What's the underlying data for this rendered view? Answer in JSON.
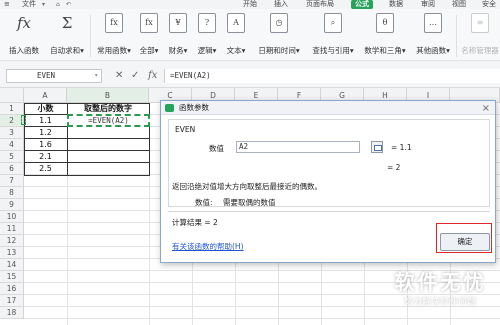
{
  "menubar": {
    "file": "文件",
    "tabs": [
      "开始",
      "插入",
      "页面布局",
      "公式",
      "数据",
      "审阅",
      "视图",
      "安全"
    ],
    "active_tab": "公式",
    "accent": "#24a35a"
  },
  "ribbon": {
    "buttons": [
      {
        "label": "插入函数",
        "icon_glyph": "fx",
        "icon": "insert-function-icon"
      },
      {
        "label": "自动求和▾",
        "icon_glyph": "Σ",
        "icon": "sigma-icon"
      },
      {
        "label": "常用函数▾",
        "icon_glyph": "fx",
        "icon": "common-function-icon"
      },
      {
        "label": "全部▾",
        "icon_glyph": "fx",
        "icon": "all-functions-icon"
      },
      {
        "label": "财务▾",
        "icon_glyph": "¥",
        "icon": "finance-icon"
      },
      {
        "label": "逻辑▾",
        "icon_glyph": "?",
        "icon": "logic-icon"
      },
      {
        "label": "文本▾",
        "icon_glyph": "A",
        "icon": "text-icon"
      },
      {
        "label": "日期和时间▾",
        "icon_glyph": "◷",
        "icon": "datetime-icon"
      },
      {
        "label": "查找与引用▾",
        "icon_glyph": "⌕",
        "icon": "lookup-icon"
      },
      {
        "label": "数学和三角▾",
        "icon_glyph": "θ",
        "icon": "math-icon"
      },
      {
        "label": "其他函数▾",
        "icon_glyph": "…",
        "icon": "other-functions-icon"
      },
      {
        "label": "名称管理器",
        "icon_glyph": "≡",
        "icon": "name-manager-icon"
      }
    ]
  },
  "formula_bar": {
    "name_box": "EVEN",
    "formula": "=EVEN(A2)"
  },
  "grid": {
    "columns": [
      "A",
      "B",
      "C",
      "D",
      "E",
      "F",
      "G",
      "H",
      "I"
    ],
    "rows": [
      "1",
      "2",
      "3",
      "4",
      "5",
      "6",
      "7",
      "8",
      "9",
      "10",
      "11",
      "12",
      "13",
      "14",
      "15",
      "16",
      "17",
      "18"
    ],
    "header_a": "小数",
    "header_b": "取整后的数字",
    "values_a": [
      "1.1",
      "1.2",
      "1.6",
      "2.1",
      "2.5"
    ],
    "b2_formula": "=EVEN(A2)"
  },
  "dialog": {
    "title": "函数参数",
    "function_name": "EVEN",
    "arg_label": "数值",
    "arg_value": "A2",
    "arg_result": "= 1.1",
    "result_preview": "= 2",
    "description": "返回沿绝对值增大方向取整后最接近的偶数。",
    "param_help_label": "数值:",
    "param_help_text": "需要取偶的数值",
    "calc_result": "计算结果 = 2",
    "help_link": "有关该函数的帮助(H)",
    "ok_label": "确定"
  },
  "watermark": {
    "title": "软件无忧",
    "subtitle": "努力解决软件问题"
  }
}
